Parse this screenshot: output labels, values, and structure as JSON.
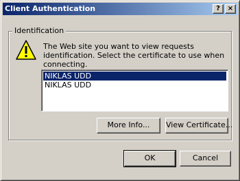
{
  "window": {
    "title": "Client Authentication",
    "help_glyph": "?",
    "close_glyph": "×"
  },
  "group": {
    "label": "Identification"
  },
  "message": "The Web site you want to view requests identification. Select the certificate to use when connecting.",
  "icon": "warning-icon",
  "certificates": [
    {
      "label": "NIKLAS UDD",
      "selected": true
    },
    {
      "label": "NIKLAS UDD",
      "selected": false
    }
  ],
  "buttons": {
    "more_info": "More Info...",
    "view_certificate": "View Certificate...",
    "ok": "OK",
    "cancel": "Cancel"
  },
  "colors": {
    "title_gradient_start": "#0a246a",
    "title_gradient_end": "#a6caf0",
    "selection": "#0a246a",
    "warning_yellow": "#ffff00"
  }
}
